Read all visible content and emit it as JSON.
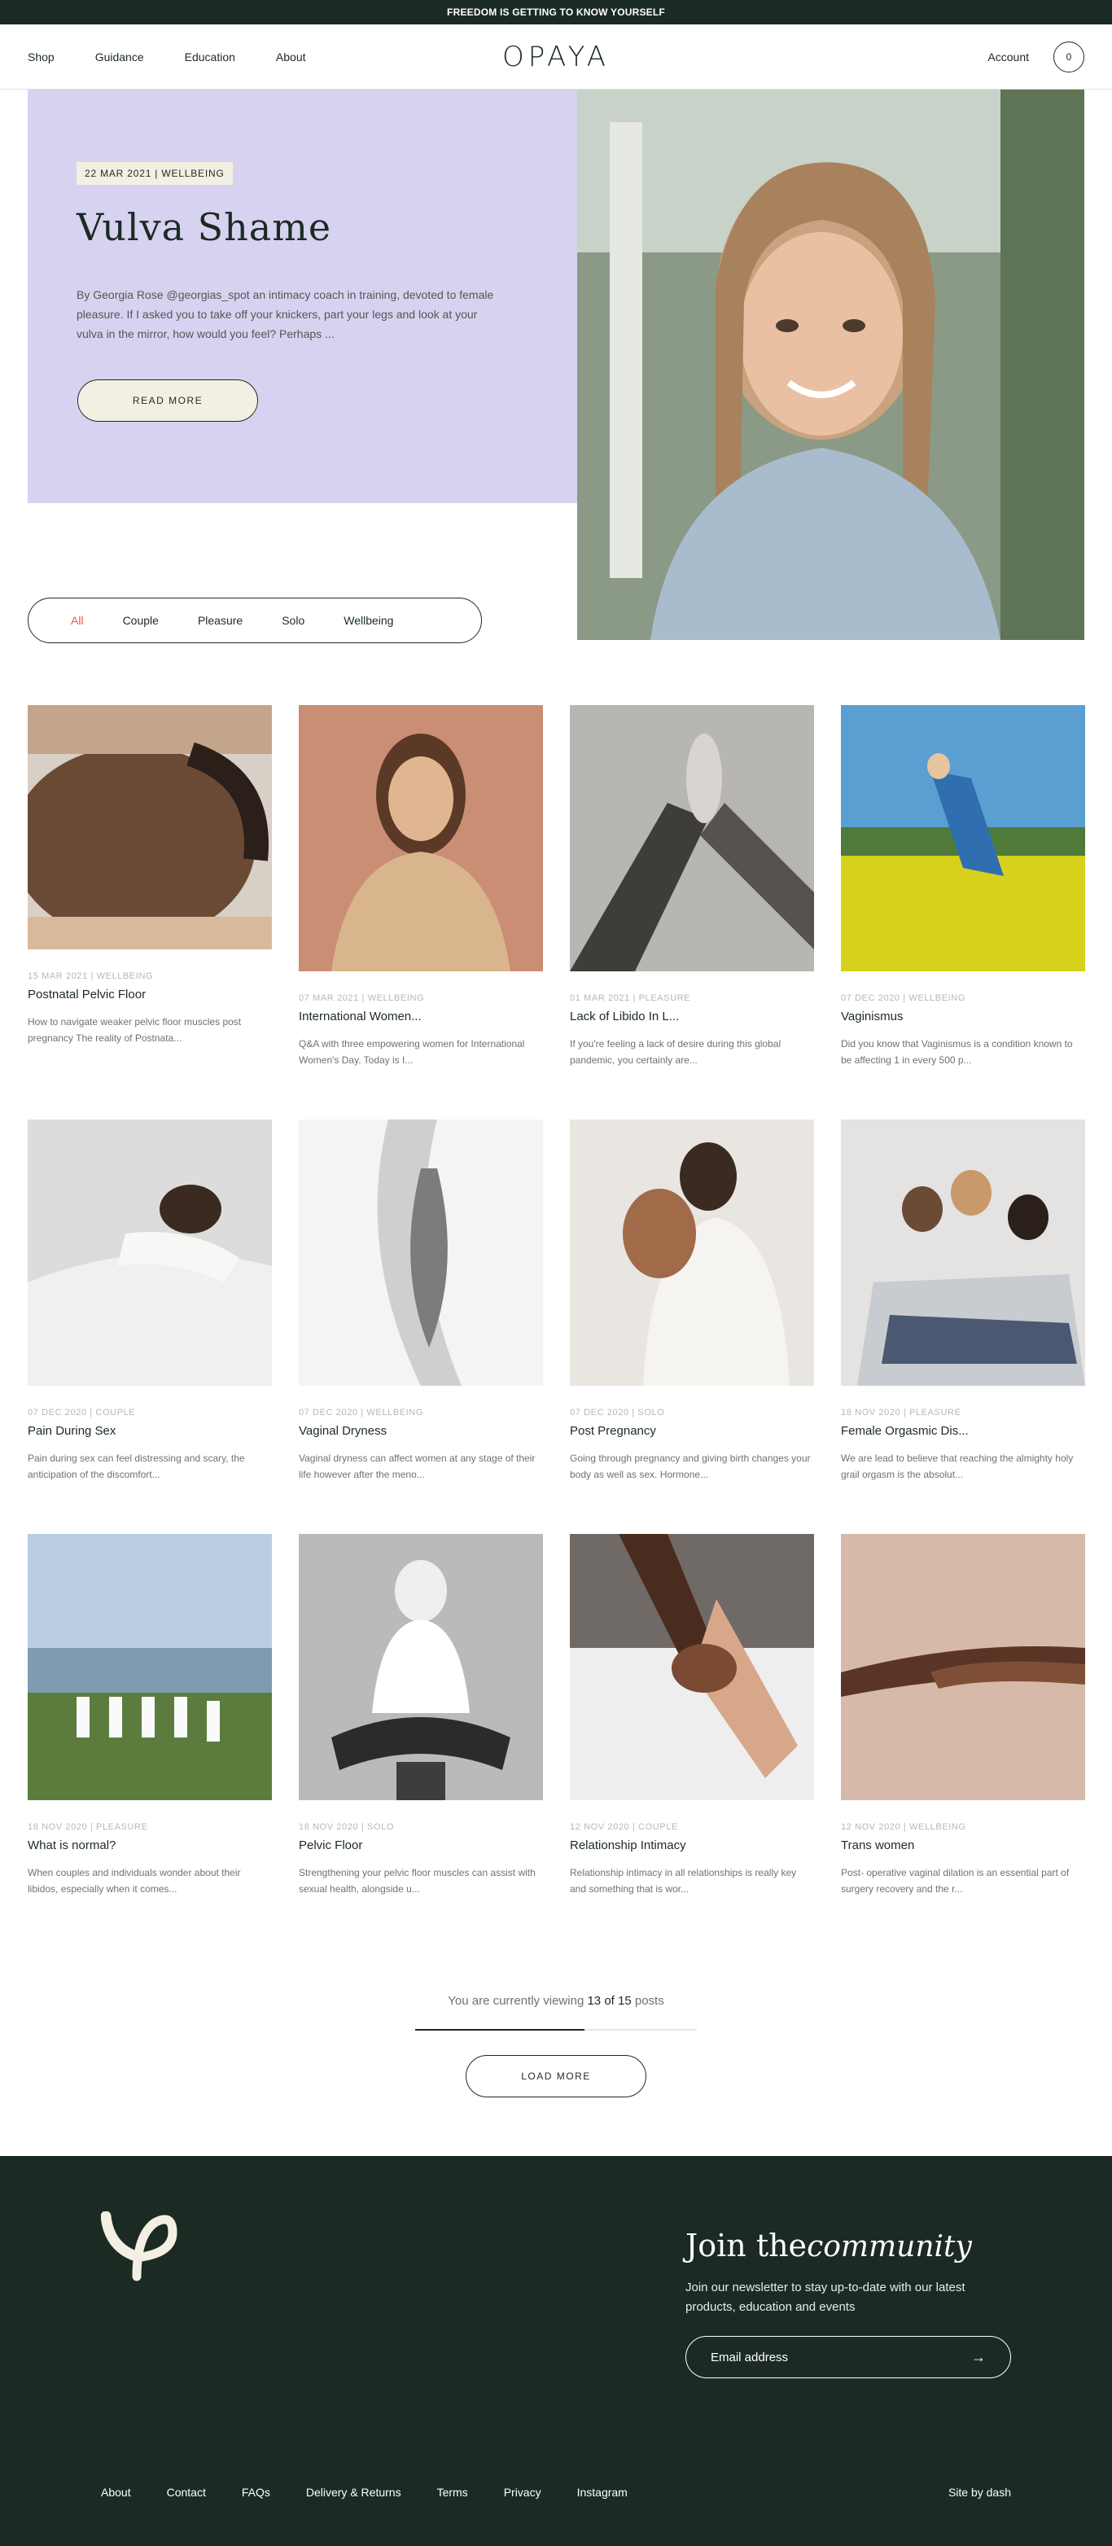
{
  "promo": {
    "text": "FREEDOM IS GETTING TO KNOW YOURSELF"
  },
  "header": {
    "nav": [
      "Shop",
      "Guidance",
      "Education",
      "About"
    ],
    "logo": "OPAYA",
    "account": "Account",
    "cart_count": "0"
  },
  "hero": {
    "tag": "22 MAR 2021 | WELLBEING",
    "title": "Vulva Shame",
    "excerpt": "By Georgia Rose @georgias_spot an intimacy coach in training, devoted to female pleasure. If I asked you to take off your knickers, part your legs and look at your vulva in the mirror, how would you feel? Perhaps ...",
    "button": "READ MORE",
    "colors": {
      "panel": "#d7d2f0",
      "tag_bg": "#f3efe2"
    }
  },
  "filters": {
    "items": [
      "All",
      "Couple",
      "Pleasure",
      "Solo",
      "Wellbeing"
    ],
    "active": "All"
  },
  "posts": [
    {
      "meta": "15 MAR 2021 | WELLBEING",
      "title": "Postnatal Pelvic Floor",
      "desc": "How to navigate weaker pelvic floor muscles post pregnancy The reality of Postnata..."
    },
    {
      "meta": "07 MAR 2021 | WELLBEING",
      "title": "International Women...",
      "desc": "Q&A with three empowering women for International Women's Day. Today is I..."
    },
    {
      "meta": "01 MAR 2021 | PLEASURE",
      "title": "Lack of Libido In L...",
      "desc": "If you're feeling a lack of desire during this global pandemic, you certainly are..."
    },
    {
      "meta": "07 DEC 2020 | WELLBEING",
      "title": "Vaginismus",
      "desc": "Did you know that Vaginismus is a condition known to be affecting 1 in every 500 p..."
    },
    {
      "meta": "07 DEC 2020 | COUPLE",
      "title": "Pain During Sex",
      "desc": "Pain during sex can feel distressing and scary, the anticipation of the discomfort..."
    },
    {
      "meta": "07 DEC 2020 | WELLBEING",
      "title": "Vaginal Dryness",
      "desc": "Vaginal dryness can affect women at any stage of their life however after the meno..."
    },
    {
      "meta": "07 DEC 2020 | SOLO",
      "title": "Post Pregnancy",
      "desc": "Going through pregnancy and giving birth changes your body as well as sex. Hormone..."
    },
    {
      "meta": "18 NOV 2020 | PLEASURE",
      "title": "Female Orgasmic Dis...",
      "desc": "We are lead to believe that reaching the almighty holy grail orgasm is the absolut..."
    },
    {
      "meta": "18 NOV 2020 | PLEASURE",
      "title": "What is normal?",
      "desc": "When couples and individuals wonder about their libidos, especially when it comes..."
    },
    {
      "meta": "18 NOV 2020 | SOLO",
      "title": "Pelvic Floor",
      "desc": "Strengthening your pelvic floor muscles can assist with sexual health, alongside u..."
    },
    {
      "meta": "12 NOV 2020 | COUPLE",
      "title": "Relationship Intimacy",
      "desc": "Relationship intimacy in all relationships is really key and something that is wor..."
    },
    {
      "meta": "12 NOV 2020 | WELLBEING",
      "title": "Trans women",
      "desc": "Post- operative vaginal dilation is an essential part of surgery recovery and the r..."
    }
  ],
  "pagination": {
    "prefix": "You are currently viewing",
    "shown": "13",
    "of_word": "of",
    "total": "15",
    "suffix": "posts",
    "progress": 0.6,
    "button": "LOAD MORE"
  },
  "footer": {
    "join_plain": "Join the",
    "join_script": "community",
    "newsletter": "Join our newsletter to stay up-to-date with our latest products, education and events",
    "email_placeholder": "Email address",
    "links": [
      "About",
      "Contact",
      "FAQs",
      "Delivery & Returns",
      "Terms",
      "Privacy",
      "Instagram"
    ],
    "site_by": "Site by dash",
    "bg": "#1b2b24"
  }
}
